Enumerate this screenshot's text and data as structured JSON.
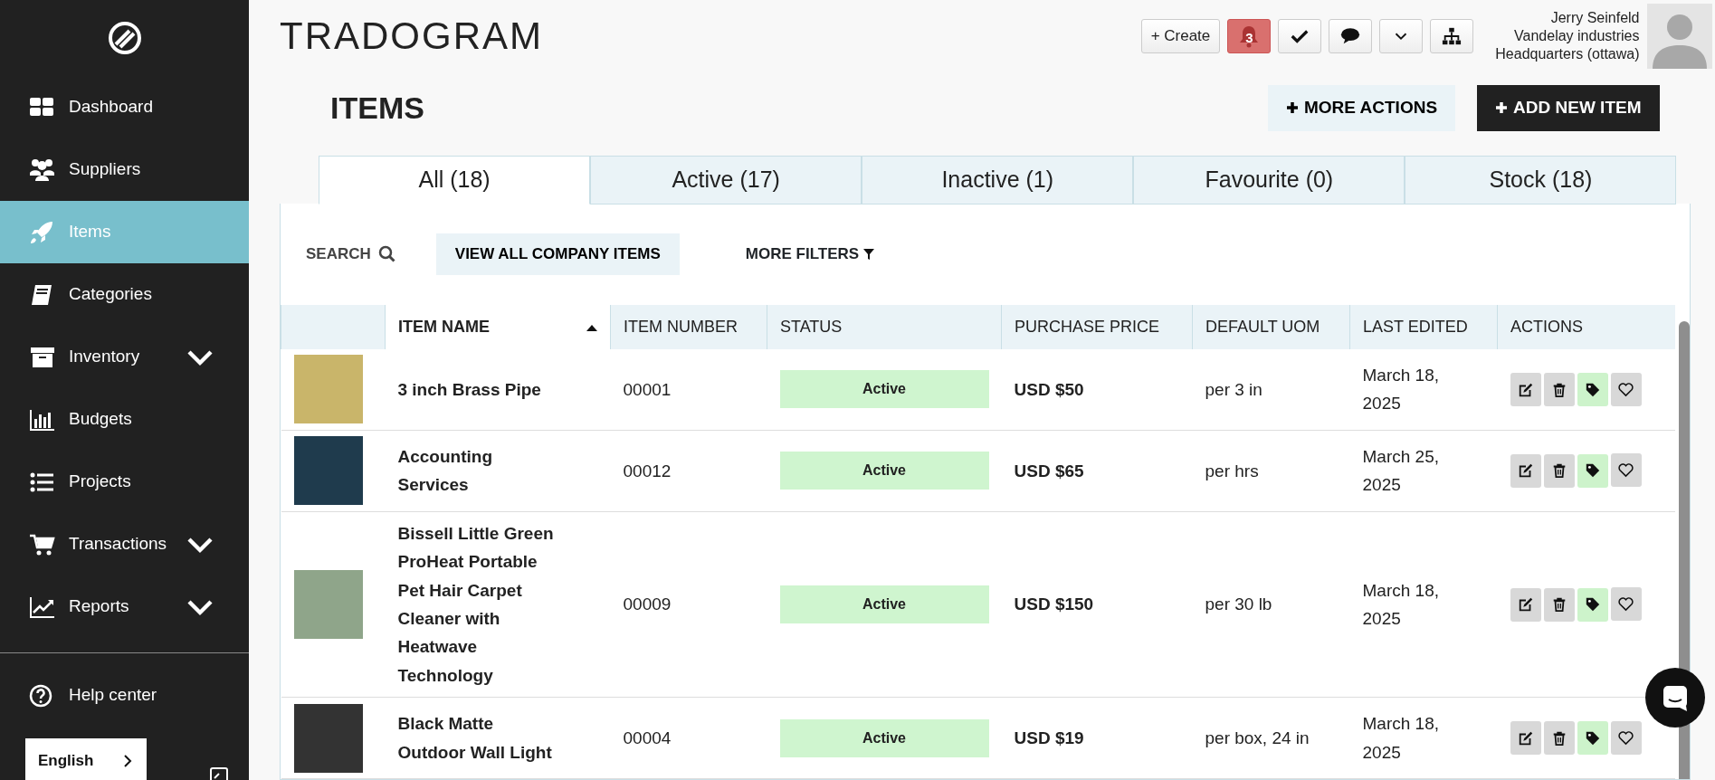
{
  "sidebar": {
    "items": [
      {
        "label": "Dashboard",
        "kind": "grid",
        "selected": false,
        "expandable": false
      },
      {
        "label": "Suppliers",
        "kind": "users",
        "selected": false,
        "expandable": false
      },
      {
        "label": "Items",
        "kind": "rocket",
        "selected": true,
        "expandable": false
      },
      {
        "label": "Categories",
        "kind": "book",
        "selected": false,
        "expandable": false
      },
      {
        "label": "Inventory",
        "kind": "box",
        "selected": false,
        "expandable": true
      },
      {
        "label": "Budgets",
        "kind": "bars",
        "selected": false,
        "expandable": false
      },
      {
        "label": "Projects",
        "kind": "list",
        "selected": false,
        "expandable": false
      },
      {
        "label": "Transactions",
        "kind": "cart",
        "selected": false,
        "expandable": true
      },
      {
        "label": "Reports",
        "kind": "trend",
        "selected": false,
        "expandable": true
      }
    ],
    "help": "Help center",
    "language": "English"
  },
  "header": {
    "brand": "TRADOGRAM",
    "create": "+ Create",
    "notifications": "3",
    "user": {
      "name": "Jerry Seinfeld",
      "company": "Vandelay industries",
      "location": "Headquarters (ottawa)"
    }
  },
  "page": {
    "title": "ITEMS",
    "more_actions": "MORE ACTIONS",
    "add_new": "ADD NEW ITEM"
  },
  "tabs": [
    {
      "label": "All (18)",
      "selected": true
    },
    {
      "label": "Active (17)",
      "selected": false
    },
    {
      "label": "Inactive (1)",
      "selected": false
    },
    {
      "label": "Favourite (0)",
      "selected": false
    },
    {
      "label": "Stock (18)",
      "selected": false
    }
  ],
  "filters": {
    "search": "SEARCH",
    "view_all": "VIEW ALL COMPANY ITEMS",
    "more_filters": "MORE FILTERS"
  },
  "table": {
    "columns": [
      {
        "label": "ITEM NAME",
        "sorted": true
      },
      {
        "label": "ITEM NUMBER",
        "sorted": false
      },
      {
        "label": "STATUS",
        "sorted": false
      },
      {
        "label": "PURCHASE PRICE",
        "sorted": false
      },
      {
        "label": "DEFAULT UOM",
        "sorted": false
      },
      {
        "label": "LAST EDITED",
        "sorted": false
      },
      {
        "label": "ACTIONS",
        "sorted": false
      }
    ],
    "rows": [
      {
        "name": "3 inch Brass Pipe",
        "number": "00001",
        "status": "Active",
        "price": "USD $50",
        "uom": "per 3 in",
        "edited": "March 18, 2025",
        "tagged": true,
        "favourite": false
      },
      {
        "name": "Accounting Services",
        "number": "00012",
        "status": "Active",
        "price": "USD $65",
        "uom": "per hrs",
        "edited": "March 25, 2025",
        "tagged": true,
        "favourite": false
      },
      {
        "name": "Bissell Little Green ProHeat Portable Pet Hair Carpet Cleaner with Heatwave Technology",
        "number": "00009",
        "status": "Active",
        "price": "USD $150",
        "uom": "per 30 lb",
        "edited": "March 18, 2025",
        "tagged": true,
        "favourite": false
      },
      {
        "name": "Black Matte Outdoor Wall Light",
        "number": "00004",
        "status": "Active",
        "price": "USD $19",
        "uom": "per box, 24 in",
        "edited": "March 18, 2025",
        "tagged": true,
        "favourite": false
      }
    ]
  }
}
